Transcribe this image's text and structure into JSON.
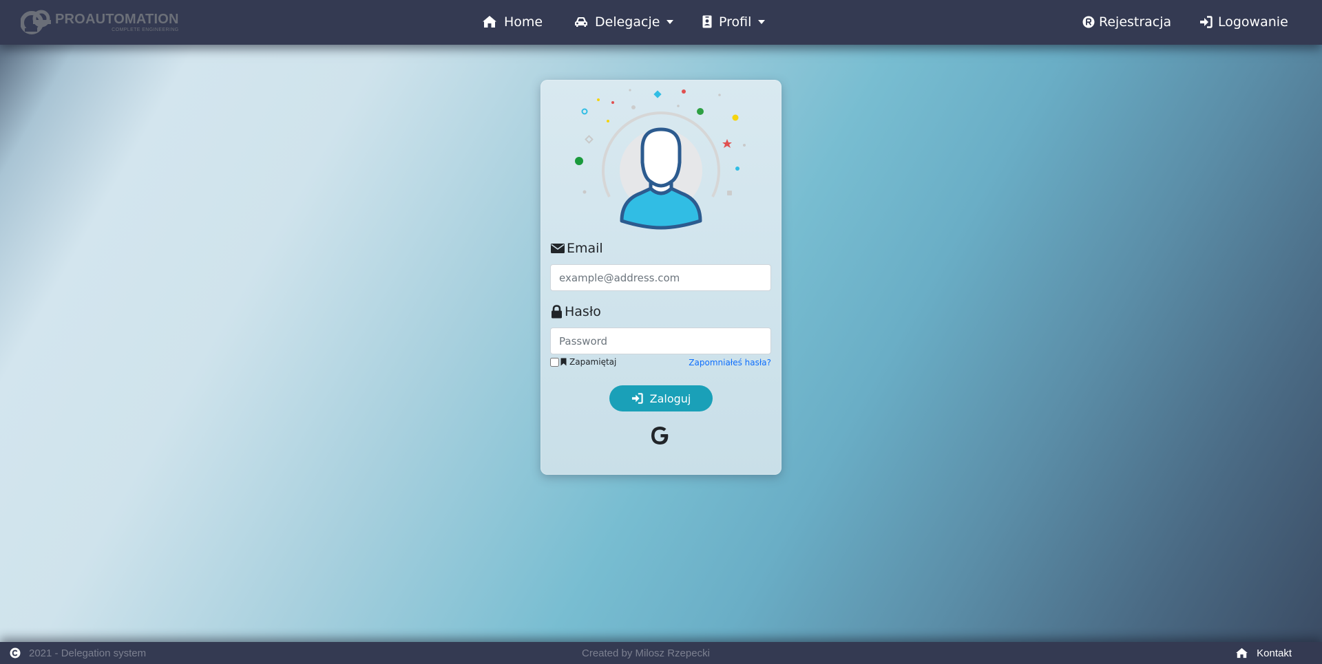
{
  "app": {
    "brand_name": "PROAUTOMATION",
    "brand_tagline": "COMPLETE ENGINEERING"
  },
  "nav": {
    "home": {
      "label": "Home",
      "icon": "home-icon"
    },
    "delegations": {
      "label": "Delegacje",
      "icon": "car-icon"
    },
    "profile": {
      "label": "Profil",
      "icon": "id-badge-icon"
    },
    "register": {
      "label": "Rejestracja",
      "icon": "registered-icon"
    },
    "login": {
      "label": "Logowanie",
      "icon": "sign-in-icon"
    }
  },
  "login_form": {
    "email_label": "Email",
    "email_placeholder": "example@address.com",
    "password_label": "Hasło",
    "password_placeholder": "Password",
    "remember_label": "Zapamiętaj",
    "forgot_link": "Zapomniałeś hasła?",
    "submit_label": "Zaloguj"
  },
  "footer": {
    "copyright": "2021 - Delegation system",
    "credits": "Created by Milosz Rzepecki",
    "contact": "Kontakt"
  },
  "colors": {
    "navbar": "#343a52",
    "button": "#1aa0b8",
    "link": "#0d6efd",
    "avatar_outline": "#2c5b8f",
    "avatar_body": "#31bde4"
  }
}
